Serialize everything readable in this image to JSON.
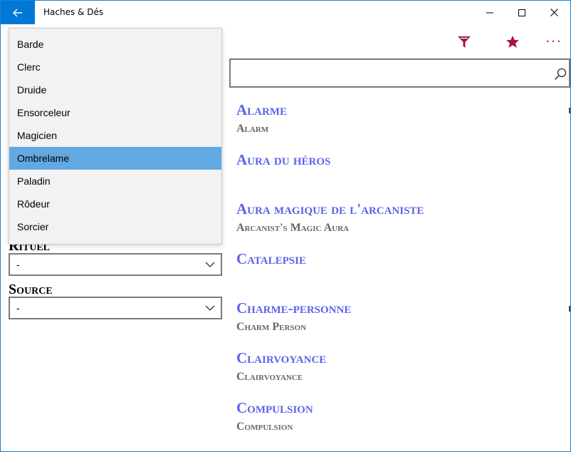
{
  "window": {
    "title": "Haches & Dés",
    "accent": "#0078d7",
    "controls": [
      "minimize",
      "maximize",
      "close"
    ]
  },
  "commandbar": {
    "filter_icon": "filter-icon",
    "favorite_icon": "star-icon",
    "more_icon": "more-icon",
    "more_label": "···",
    "icon_color": "#a5173d"
  },
  "search": {
    "value": "",
    "placeholder": ""
  },
  "dropdown": {
    "items": [
      "Barde",
      "Clerc",
      "Druide",
      "Ensorceleur",
      "Magicien",
      "Ombrelame",
      "Paladin",
      "Rôdeur",
      "Sorcier"
    ],
    "selected": "Ombrelame",
    "selected_color": "#62a9e2"
  },
  "filters": {
    "ritual": {
      "label": "Rituel",
      "value": "-"
    },
    "source": {
      "label": "Source",
      "value": "-"
    }
  },
  "spells": [
    {
      "name": "Alarme",
      "subtitle": "Alarm"
    },
    {
      "name": "Aura du héros",
      "subtitle": ""
    },
    {
      "name": "Aura magique de l'arcaniste",
      "subtitle": "Arcanist's Magic Aura"
    },
    {
      "name": "Catalepsie",
      "subtitle": ""
    },
    {
      "name": "Charme-personne",
      "subtitle": "Charm Person"
    },
    {
      "name": "Clairvoyance",
      "subtitle": "Clairvoyance"
    },
    {
      "name": "Compulsion",
      "subtitle": "Compulsion"
    }
  ],
  "colors": {
    "spell_name": "#5c63ea",
    "spell_subtitle": "#666666"
  }
}
